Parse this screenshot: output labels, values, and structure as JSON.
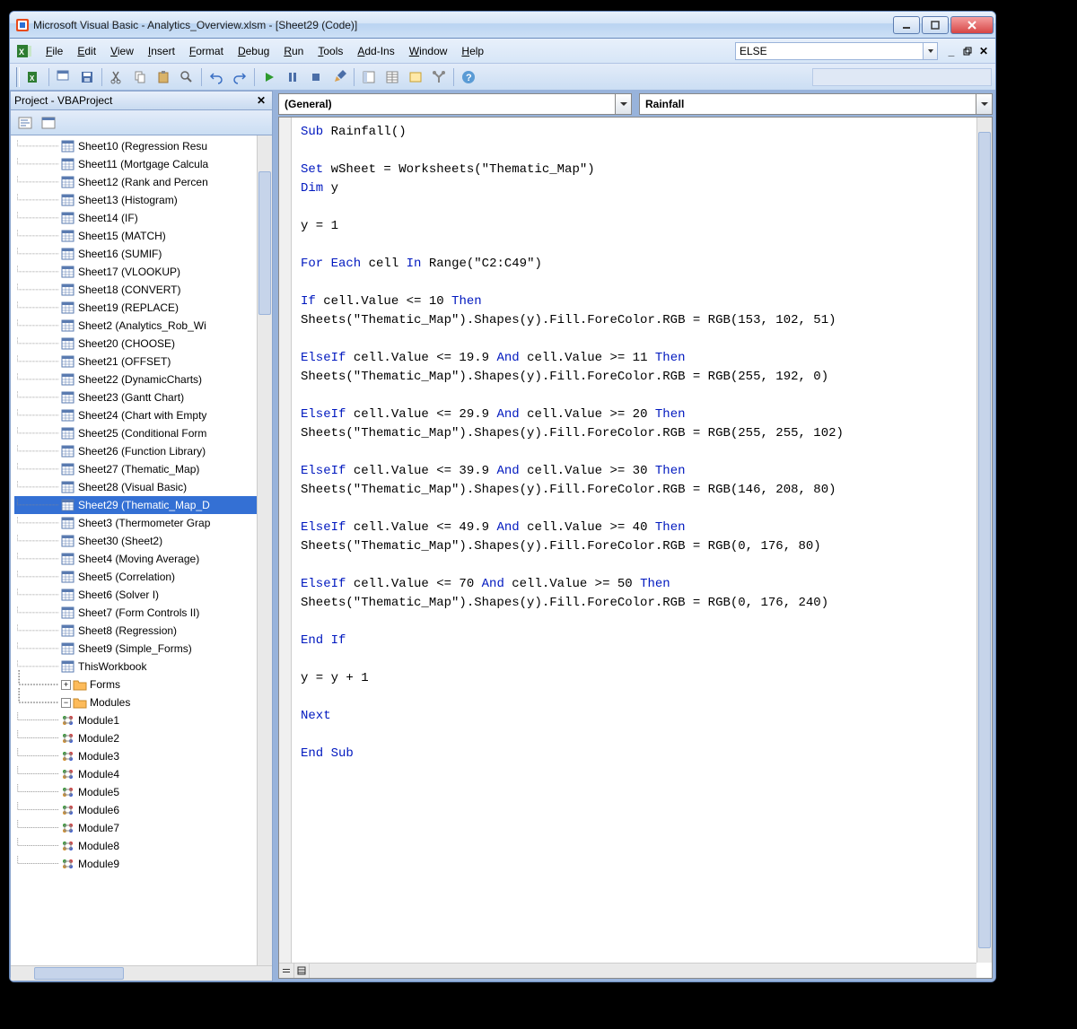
{
  "window": {
    "title": "Microsoft Visual Basic - Analytics_Overview.xlsm - [Sheet29 (Code)]"
  },
  "menu": {
    "items": [
      "File",
      "Edit",
      "View",
      "Insert",
      "Format",
      "Debug",
      "Run",
      "Tools",
      "Add-Ins",
      "Window",
      "Help"
    ],
    "search_value": "ELSE"
  },
  "project_pane": {
    "title": "Project - VBAProject",
    "sheets": [
      "Sheet10 (Regression Resu",
      "Sheet11 (Mortgage Calcula",
      "Sheet12 (Rank and Percen",
      "Sheet13 (Histogram)",
      "Sheet14 (IF)",
      "Sheet15 (MATCH)",
      "Sheet16 (SUMIF)",
      "Sheet17 (VLOOKUP)",
      "Sheet18 (CONVERT)",
      "Sheet19 (REPLACE)",
      "Sheet2 (Analytics_Rob_Wi",
      "Sheet20 (CHOOSE)",
      "Sheet21 (OFFSET)",
      "Sheet22 (DynamicCharts)",
      "Sheet23 (Gantt Chart)",
      "Sheet24 (Chart with Empty",
      "Sheet25 (Conditional Form",
      "Sheet26 (Function Library)",
      "Sheet27 (Thematic_Map)",
      "Sheet28 (Visual Basic)",
      "Sheet29 (Thematic_Map_D",
      "Sheet3 (Thermometer Grap",
      "Sheet30 (Sheet2)",
      "Sheet4 (Moving Average)",
      "Sheet5 (Correlation)",
      "Sheet6 (Solver I)",
      "Sheet7 (Form Controls II)",
      "Sheet8 (Regression)",
      "Sheet9 (Simple_Forms)",
      "ThisWorkbook"
    ],
    "selected_index": 20,
    "forms_label": "Forms",
    "modules_label": "Modules",
    "modules": [
      "Module1",
      "Module2",
      "Module3",
      "Module4",
      "Module5",
      "Module6",
      "Module7",
      "Module8",
      "Module9"
    ]
  },
  "code_pane": {
    "object_dd": "(General)",
    "proc_dd": "Rainfall",
    "lines": [
      {
        "t": "kw",
        "s": "Sub "
      },
      {
        "t": "p",
        "s": "Rainfall()"
      },
      {
        "t": "br"
      },
      {
        "t": "br"
      },
      {
        "t": "kw",
        "s": "Set "
      },
      {
        "t": "p",
        "s": "wSheet = Worksheets(\"Thematic_Map\")"
      },
      {
        "t": "br"
      },
      {
        "t": "kw",
        "s": "Dim "
      },
      {
        "t": "p",
        "s": "y"
      },
      {
        "t": "br"
      },
      {
        "t": "br"
      },
      {
        "t": "p",
        "s": "y = 1"
      },
      {
        "t": "br"
      },
      {
        "t": "br"
      },
      {
        "t": "kw",
        "s": "For Each "
      },
      {
        "t": "p",
        "s": "cell "
      },
      {
        "t": "kw",
        "s": "In "
      },
      {
        "t": "p",
        "s": "Range(\"C2:C49\")"
      },
      {
        "t": "br"
      },
      {
        "t": "br"
      },
      {
        "t": "kw",
        "s": "If "
      },
      {
        "t": "p",
        "s": "cell.Value <= 10 "
      },
      {
        "t": "kw",
        "s": "Then"
      },
      {
        "t": "br"
      },
      {
        "t": "p",
        "s": "Sheets(\"Thematic_Map\").Shapes(y).Fill.ForeColor.RGB = RGB(153, 102, 51)"
      },
      {
        "t": "br"
      },
      {
        "t": "br"
      },
      {
        "t": "kw",
        "s": "ElseIf "
      },
      {
        "t": "p",
        "s": "cell.Value <= 19.9 "
      },
      {
        "t": "kw",
        "s": "And "
      },
      {
        "t": "p",
        "s": "cell.Value >= 11 "
      },
      {
        "t": "kw",
        "s": "Then"
      },
      {
        "t": "br"
      },
      {
        "t": "p",
        "s": "Sheets(\"Thematic_Map\").Shapes(y).Fill.ForeColor.RGB = RGB(255, 192, 0)"
      },
      {
        "t": "br"
      },
      {
        "t": "br"
      },
      {
        "t": "kw",
        "s": "ElseIf "
      },
      {
        "t": "p",
        "s": "cell.Value <= 29.9 "
      },
      {
        "t": "kw",
        "s": "And "
      },
      {
        "t": "p",
        "s": "cell.Value >= 20 "
      },
      {
        "t": "kw",
        "s": "Then"
      },
      {
        "t": "br"
      },
      {
        "t": "p",
        "s": "Sheets(\"Thematic_Map\").Shapes(y).Fill.ForeColor.RGB = RGB(255, 255, 102)"
      },
      {
        "t": "br"
      },
      {
        "t": "br"
      },
      {
        "t": "kw",
        "s": "ElseIf "
      },
      {
        "t": "p",
        "s": "cell.Value <= 39.9 "
      },
      {
        "t": "kw",
        "s": "And "
      },
      {
        "t": "p",
        "s": "cell.Value >= 30 "
      },
      {
        "t": "kw",
        "s": "Then"
      },
      {
        "t": "br"
      },
      {
        "t": "p",
        "s": "Sheets(\"Thematic_Map\").Shapes(y).Fill.ForeColor.RGB = RGB(146, 208, 80)"
      },
      {
        "t": "br"
      },
      {
        "t": "br"
      },
      {
        "t": "kw",
        "s": "ElseIf "
      },
      {
        "t": "p",
        "s": "cell.Value <= 49.9 "
      },
      {
        "t": "kw",
        "s": "And "
      },
      {
        "t": "p",
        "s": "cell.Value >= 40 "
      },
      {
        "t": "kw",
        "s": "Then"
      },
      {
        "t": "br"
      },
      {
        "t": "p",
        "s": "Sheets(\"Thematic_Map\").Shapes(y).Fill.ForeColor.RGB = RGB(0, 176, 80)"
      },
      {
        "t": "br"
      },
      {
        "t": "br"
      },
      {
        "t": "kw",
        "s": "ElseIf "
      },
      {
        "t": "p",
        "s": "cell.Value <= 70 "
      },
      {
        "t": "kw",
        "s": "And "
      },
      {
        "t": "p",
        "s": "cell.Value >= 50 "
      },
      {
        "t": "kw",
        "s": "Then"
      },
      {
        "t": "br"
      },
      {
        "t": "p",
        "s": "Sheets(\"Thematic_Map\").Shapes(y).Fill.ForeColor.RGB = RGB(0, 176, 240)"
      },
      {
        "t": "br"
      },
      {
        "t": "br"
      },
      {
        "t": "kw",
        "s": "End If"
      },
      {
        "t": "br"
      },
      {
        "t": "br"
      },
      {
        "t": "p",
        "s": "y = y + 1"
      },
      {
        "t": "br"
      },
      {
        "t": "br"
      },
      {
        "t": "kw",
        "s": "Next"
      },
      {
        "t": "br"
      },
      {
        "t": "br"
      },
      {
        "t": "kw",
        "s": "End Sub"
      },
      {
        "t": "br"
      }
    ]
  }
}
